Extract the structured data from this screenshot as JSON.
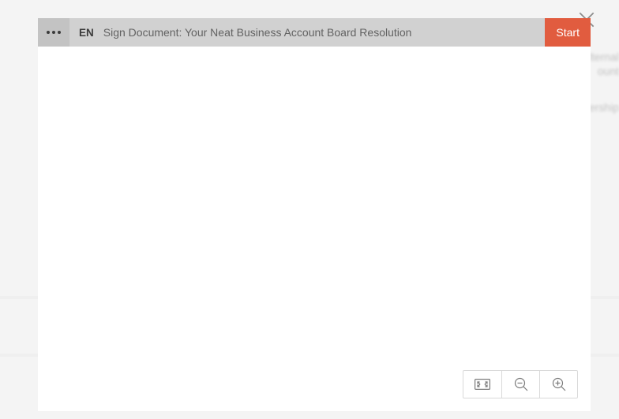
{
  "header": {
    "language": "EN",
    "title": "Sign Document: Your Neat Business Account Board Resolution",
    "start_label": "Start"
  },
  "icons": {
    "more": "more-icon",
    "close": "close-icon",
    "fit": "fit-to-screen-icon",
    "zoom_out": "zoom-out-icon",
    "zoom_in": "zoom-in-icon"
  },
  "colors": {
    "toolbar_bg": "#d1d1d1",
    "more_bg": "#c3c3c3",
    "accent": "#e15c3f",
    "text_muted": "#626262"
  },
  "background_hints": {
    "blur1": "lternal",
    "blur2": "ount",
    "blur3": "ership"
  }
}
